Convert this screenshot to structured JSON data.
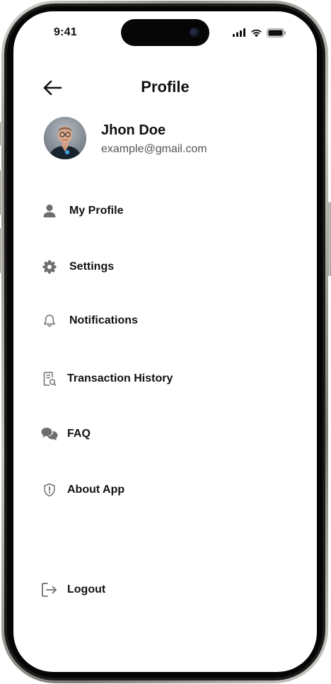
{
  "status_bar": {
    "time": "9:41"
  },
  "header": {
    "title": "Profile",
    "back_icon": "arrow-left-icon"
  },
  "user": {
    "name": "Jhon Doe",
    "email": "example@gmail.com"
  },
  "menu": {
    "items": [
      {
        "label": "My Profile",
        "icon": "person-icon"
      },
      {
        "label": "Settings",
        "icon": "gear-icon"
      },
      {
        "label": "Notifications",
        "icon": "bell-icon"
      },
      {
        "label": "Transaction History",
        "icon": "receipt-search-icon"
      },
      {
        "label": "FAQ",
        "icon": "chat-bubbles-icon"
      },
      {
        "label": "About App",
        "icon": "shield-alert-icon"
      }
    ],
    "logout": {
      "label": "Logout",
      "icon": "logout-icon"
    }
  },
  "colors": {
    "icon": "#6f6f6f",
    "text": "#111111",
    "secondary_text": "#555555"
  }
}
